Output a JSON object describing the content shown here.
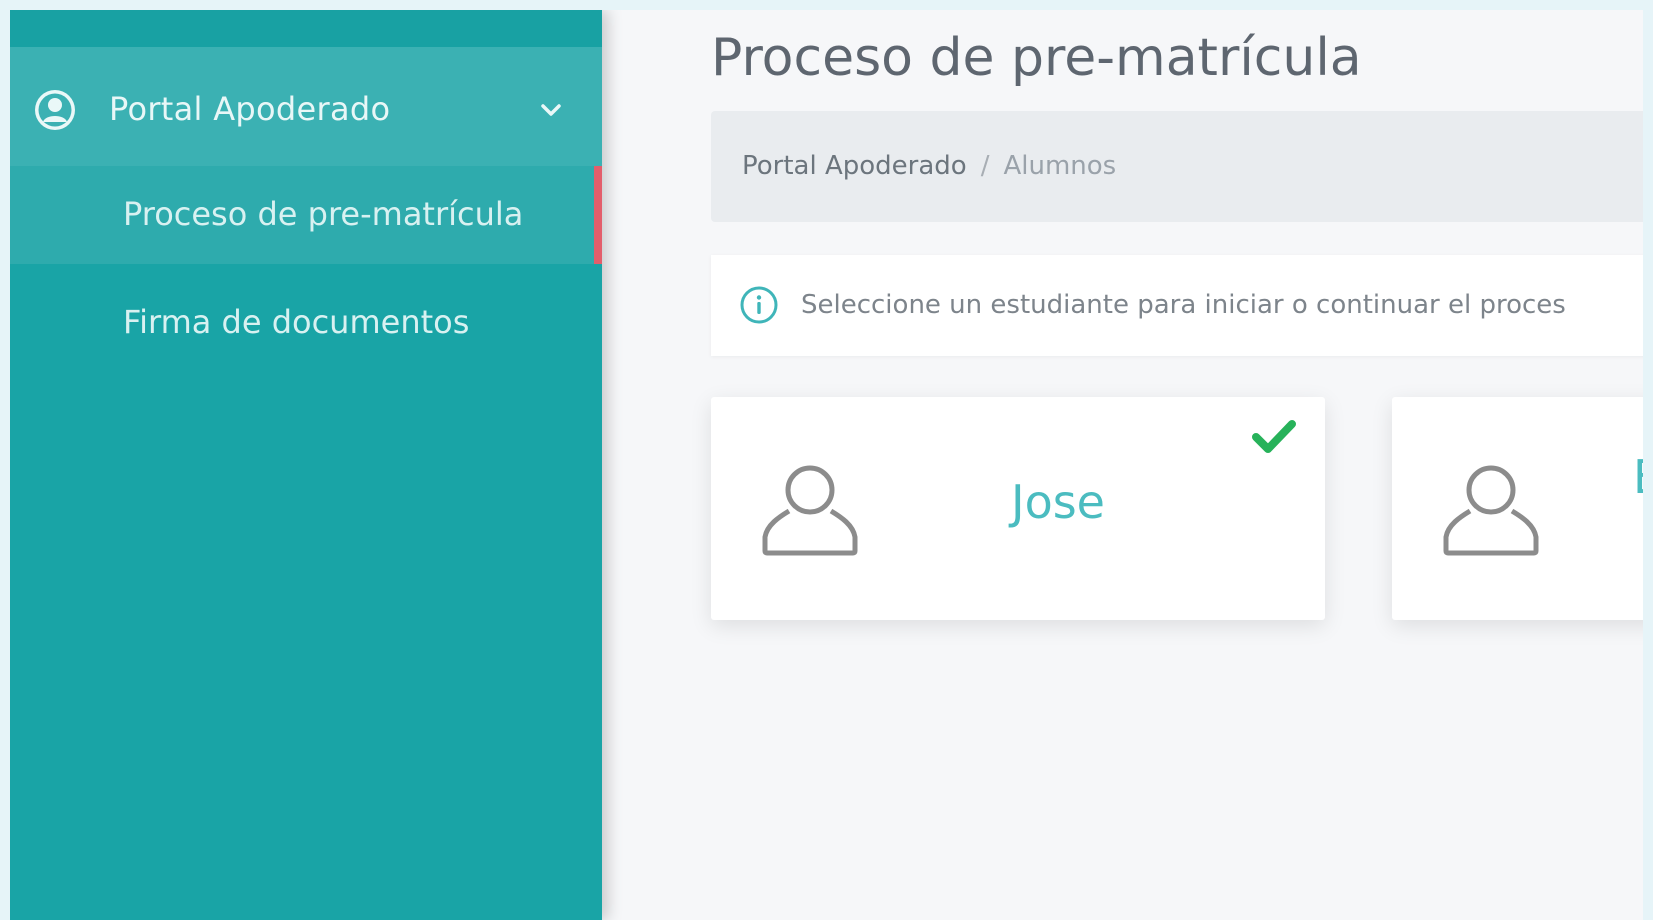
{
  "sidebar": {
    "parent_label": "Portal Apoderado",
    "items": [
      {
        "label": "Proceso de pre-matrícula",
        "active": true
      },
      {
        "label": "Firma de documentos",
        "active": false
      }
    ]
  },
  "main": {
    "title": "Proceso de pre-matrícula",
    "breadcrumb": {
      "parent": "Portal Apoderado",
      "separator": "/",
      "current": "Alumnos"
    },
    "info_text": "Seleccione un estudiante para iniciar o continuar el proces",
    "students": [
      {
        "name": "Jose",
        "completed": true
      },
      {
        "name": "E",
        "completed": false
      }
    ]
  },
  "colors": {
    "sidebar": "#19a4a6",
    "active_accent": "#e35e6b",
    "student_name": "#4bbcc0",
    "check": "#27b25a"
  }
}
